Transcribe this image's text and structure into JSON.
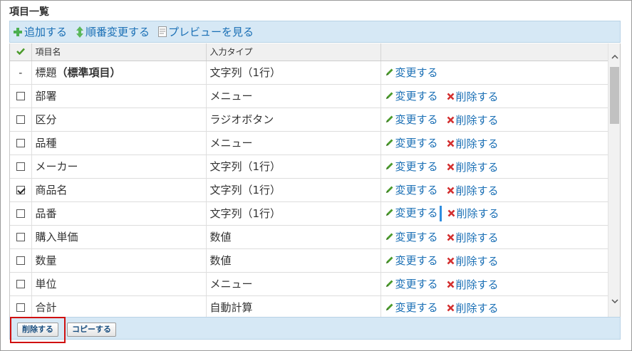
{
  "title": "項目一覧",
  "toolbar": {
    "add_label": "追加する",
    "reorder_label": "順番変更する",
    "preview_label": "プレビューを見る"
  },
  "table": {
    "headers": [
      "",
      "項目名",
      "入力タイプ",
      ""
    ],
    "rows": [
      {
        "check": "-",
        "name": "標題",
        "name_suffix": "（標準項目）",
        "type": "文字列（1行）",
        "edit": "変更する",
        "delete": ""
      },
      {
        "check": "off",
        "name": "部署",
        "name_suffix": "",
        "type": "メニュー",
        "edit": "変更する",
        "delete": "削除する"
      },
      {
        "check": "off",
        "name": "区分",
        "name_suffix": "",
        "type": "ラジオボタン",
        "edit": "変更する",
        "delete": "削除する"
      },
      {
        "check": "off",
        "name": "品種",
        "name_suffix": "",
        "type": "メニュー",
        "edit": "変更する",
        "delete": "削除する"
      },
      {
        "check": "off",
        "name": "メーカー",
        "name_suffix": "",
        "type": "文字列（1行）",
        "edit": "変更する",
        "delete": "削除する"
      },
      {
        "check": "on",
        "name": "商品名",
        "name_suffix": "",
        "type": "文字列（1行）",
        "edit": "変更する",
        "delete": "削除する"
      },
      {
        "check": "off",
        "name": "品番",
        "name_suffix": "",
        "type": "文字列（1行）",
        "edit": "変更する",
        "delete": "削除する"
      },
      {
        "check": "off",
        "name": "購入単価",
        "name_suffix": "",
        "type": "数値",
        "edit": "変更する",
        "delete": "削除する"
      },
      {
        "check": "off",
        "name": "数量",
        "name_suffix": "",
        "type": "数値",
        "edit": "変更する",
        "delete": "削除する"
      },
      {
        "check": "off",
        "name": "単位",
        "name_suffix": "",
        "type": "メニュー",
        "edit": "変更する",
        "delete": "削除する"
      },
      {
        "check": "off",
        "name": "合計",
        "name_suffix": "",
        "type": "自動計算",
        "edit": "変更する",
        "delete": "削除する"
      }
    ]
  },
  "bottom": {
    "delete_label": "削除する",
    "copy_label": "コピーする"
  },
  "colors": {
    "link": "#1a6fb5",
    "toolbar_bg": "#d6e8f5",
    "highlight": "#d01010",
    "delete_icon": "#d32f2f",
    "edit_icon": "#4a9a2a"
  }
}
